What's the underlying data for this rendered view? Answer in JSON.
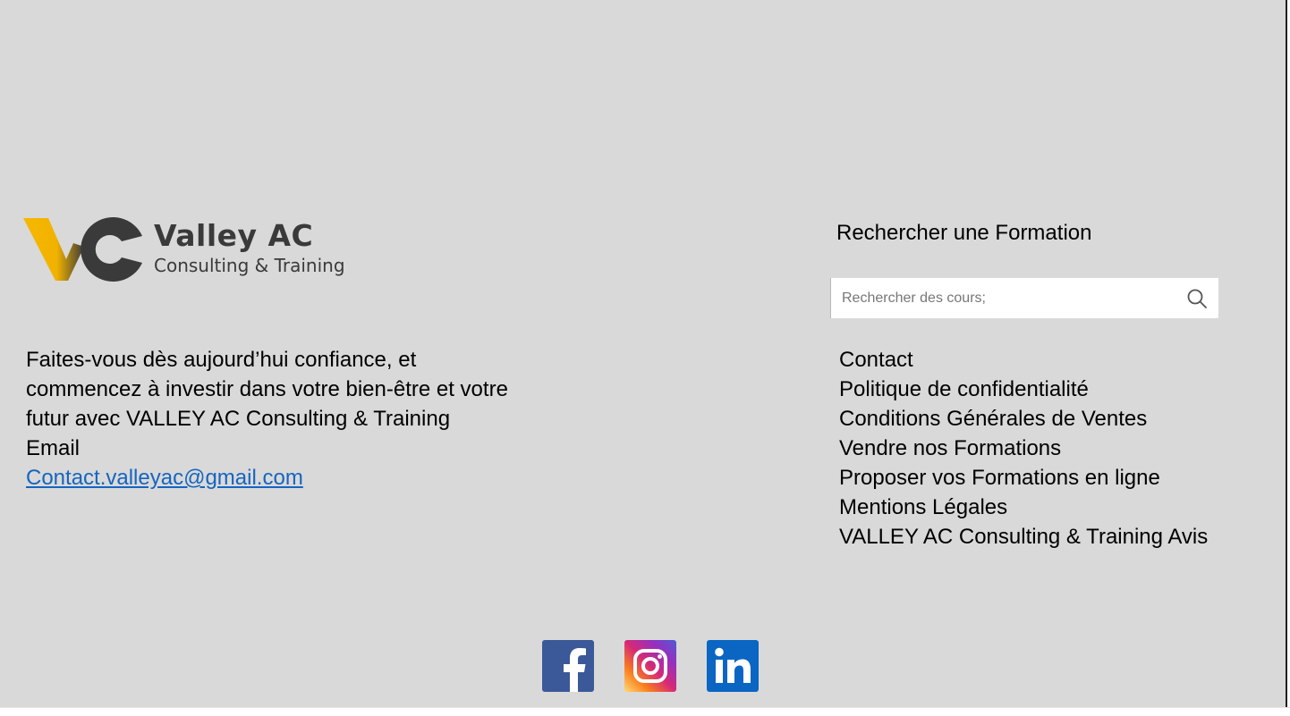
{
  "brand": {
    "name": "Valley AC",
    "tagline": "Consulting & Training"
  },
  "about": {
    "lines": [
      "Faites-vous dès aujourd’hui confiance, et",
      "commencez à investir dans votre bien-être et votre",
      "futur avec VALLEY AC Consulting & Training"
    ],
    "email_label": "Email",
    "email": "Contact.valleyac@gmail.com"
  },
  "search": {
    "title": "Rechercher une Formation",
    "placeholder": "Rechercher des cours;"
  },
  "links": [
    "Contact",
    "Politique de confidentialité",
    "Conditions Générales de Ventes",
    "Vendre nos Formations",
    "Proposer vos Formations en ligne",
    "Mentions Légales",
    "VALLEY AC Consulting & Training Avis"
  ],
  "social": [
    "facebook-icon",
    "instagram-icon",
    "linkedin-icon"
  ],
  "colors": {
    "background": "#d9d9d9",
    "link": "#1565c0",
    "logo_yellow": "#f5b800",
    "logo_dark": "#3a3a3a",
    "facebook": "#3b5998",
    "linkedin": "#0a66c2"
  }
}
